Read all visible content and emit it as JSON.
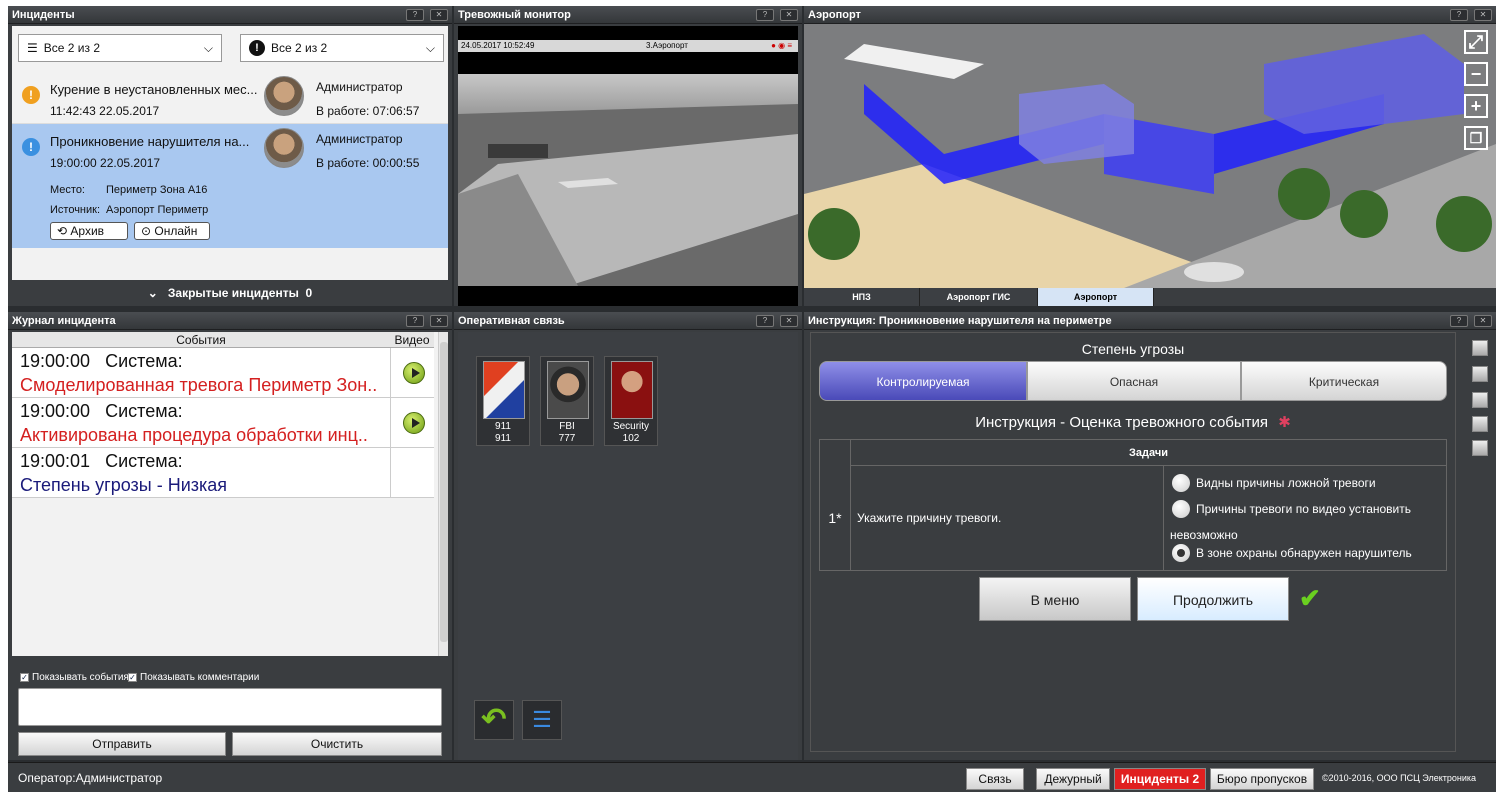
{
  "incidents": {
    "title": "Инциденты",
    "filter1": "Все  2 из 2",
    "filter2": "Все  2 из 2",
    "items": [
      {
        "title": "Курение в неустановленных мес...",
        "time": "11:42:43 22.05.2017",
        "user": "Администратор",
        "work": "В работе: 07:06:57"
      },
      {
        "title": "Проникновение нарушителя на...",
        "time": "19:00:00 22.05.2017",
        "user": "Администратор",
        "work": "В работе: 00:00:55"
      }
    ],
    "place_label": "Место:",
    "place_value": "Периметр Зона А16",
    "source_label": "Источник:",
    "source_value": "Аэропорт Периметр",
    "archive_btn": "Архив",
    "online_btn": "Онлайн",
    "closed_label": "Закрытые инциденты",
    "closed_count": "0"
  },
  "alarm_monitor": {
    "title": "Тревожный монитор",
    "timestamp": "24.05.2017 10:52:49",
    "camera": "3.Аэропорт"
  },
  "map": {
    "title": "Аэропорт",
    "tabs": [
      "НПЗ",
      "Аэропорт ГИС",
      "Аэропорт"
    ],
    "active_tab": "Аэропорт"
  },
  "journal": {
    "title": "Журнал инцидента",
    "col_events": "События",
    "col_video": "Видео",
    "rows": [
      {
        "time": "19:00:00",
        "source": "Система:",
        "text": "Смоделированная тревога Периметр Зон..",
        "color": "#d42020",
        "has_video": true
      },
      {
        "time": "19:00:00",
        "source": "Система:",
        "text": "Активирована процедура обработки инц..",
        "color": "#d42020",
        "has_video": true
      },
      {
        "time": "19:00:01",
        "source": "Система:",
        "text": "Степень угрозы - Низкая",
        "color": "#1a1a7a",
        "has_video": false
      }
    ],
    "show_events": "Показывать события",
    "show_comments": "Показывать комментарии",
    "send_btn": "Отправить",
    "clear_btn": "Очистить"
  },
  "comms": {
    "title": "Оперативная связь",
    "contacts": [
      {
        "name": "911",
        "number": "911"
      },
      {
        "name": "FBI",
        "number": "777"
      },
      {
        "name": "Security",
        "number": "102"
      }
    ]
  },
  "instruction": {
    "title": "Инструкция: Проникновение нарушителя на периметре",
    "threat_label": "Степень угрозы",
    "threat_levels": [
      "Контролируемая",
      "Опасная",
      "Критическая"
    ],
    "heading": "Инструкция - Оценка тревожного события",
    "tasks_header": "Задачи",
    "task_num": "1*",
    "task_text": "Укажите причину тревоги.",
    "options": [
      "Видны причины ложной тревоги",
      "Причины тревоги по видео установить",
      "невозможно",
      "В зоне охраны обнаружен нарушитель"
    ],
    "menu_btn": "В меню",
    "continue_btn": "Продолжить"
  },
  "status": {
    "operator": "Оператор:Администратор",
    "btn_comms": "Связь",
    "btn_duty": "Дежурный",
    "btn_incidents": "Инциденты 2",
    "btn_pass": "Бюро пропусков",
    "copyright": "©2010-2016, ООО ПСЦ Электроника"
  },
  "colors": {
    "accent": "#a9c8f0",
    "alert": "#e02020",
    "threat_active": "#5a5ad0"
  }
}
